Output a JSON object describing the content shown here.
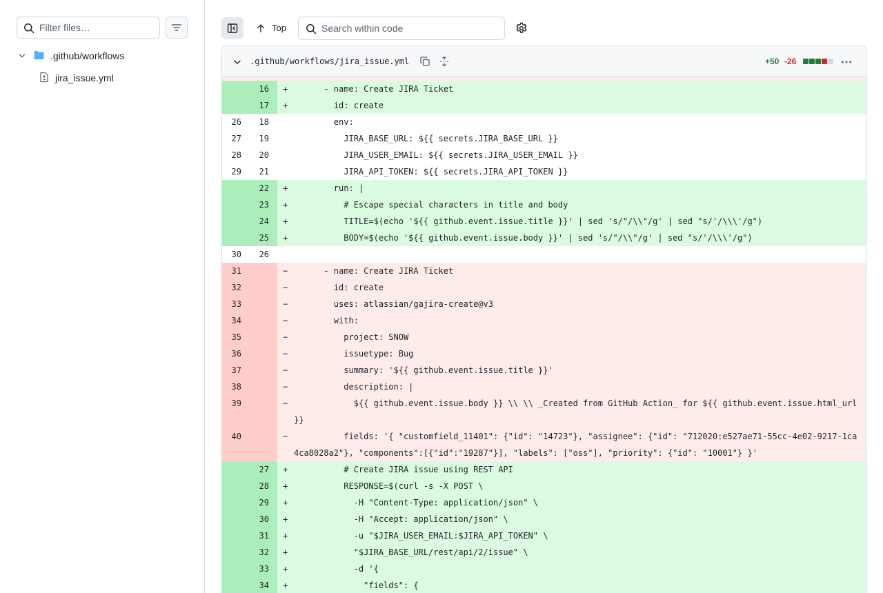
{
  "sidebar": {
    "filter_placeholder": "Filter files…",
    "tree": {
      "folder": ".github/workflows",
      "file": "jira_issue.yml"
    }
  },
  "toolbar": {
    "top_label": "Top",
    "search_placeholder": "Search within code"
  },
  "diff": {
    "file_path": ".github/workflows/jira_issue.yml",
    "additions": "+50",
    "deletions": "-26",
    "blocks": [
      "add",
      "add",
      "add",
      "del",
      "neu"
    ],
    "lines": [
      {
        "type": "add",
        "old": "",
        "new": "16",
        "marker": "+",
        "code": "      - name: Create JIRA Ticket"
      },
      {
        "type": "add",
        "old": "",
        "new": "17",
        "marker": "+",
        "code": "        id: create"
      },
      {
        "type": "ctx",
        "old": "26",
        "new": "18",
        "marker": "",
        "code": "        env:"
      },
      {
        "type": "ctx",
        "old": "27",
        "new": "19",
        "marker": "",
        "code": "          JIRA_BASE_URL: ${{ secrets.JIRA_BASE_URL }}"
      },
      {
        "type": "ctx",
        "old": "28",
        "new": "20",
        "marker": "",
        "code": "          JIRA_USER_EMAIL: ${{ secrets.JIRA_USER_EMAIL }}"
      },
      {
        "type": "ctx",
        "old": "29",
        "new": "21",
        "marker": "",
        "code": "          JIRA_API_TOKEN: ${{ secrets.JIRA_API_TOKEN }}"
      },
      {
        "type": "add",
        "old": "",
        "new": "22",
        "marker": "+",
        "code": "        run: |"
      },
      {
        "type": "add",
        "old": "",
        "new": "23",
        "marker": "+",
        "code": "          # Escape special characters in title and body"
      },
      {
        "type": "add",
        "old": "",
        "new": "24",
        "marker": "+",
        "code": "          TITLE=$(echo '${{ github.event.issue.title }}' | sed 's/\"/\\\\\"/g' | sed \"s/'/\\\\\\'/g\")"
      },
      {
        "type": "add",
        "old": "",
        "new": "25",
        "marker": "+",
        "code": "          BODY=$(echo '${{ github.event.issue.body }}' | sed 's/\"/\\\\\"/g' | sed \"s/'/\\\\\\'/g\")"
      },
      {
        "type": "ctx",
        "old": "30",
        "new": "26",
        "marker": "",
        "code": ""
      },
      {
        "type": "del",
        "old": "31",
        "new": "",
        "marker": "−",
        "code": "      - name: Create JIRA Ticket"
      },
      {
        "type": "del",
        "old": "32",
        "new": "",
        "marker": "−",
        "code": "        id: create"
      },
      {
        "type": "del",
        "old": "33",
        "new": "",
        "marker": "−",
        "code": "        uses: atlassian/gajira-create@v3"
      },
      {
        "type": "del",
        "old": "34",
        "new": "",
        "marker": "−",
        "code": "        with:"
      },
      {
        "type": "del",
        "old": "35",
        "new": "",
        "marker": "−",
        "code": "          project: SNOW"
      },
      {
        "type": "del",
        "old": "36",
        "new": "",
        "marker": "−",
        "code": "          issuetype: Bug"
      },
      {
        "type": "del",
        "old": "37",
        "new": "",
        "marker": "−",
        "code": "          summary: '${{ github.event.issue.title }}'"
      },
      {
        "type": "del",
        "old": "38",
        "new": "",
        "marker": "−",
        "code": "          description: |"
      },
      {
        "type": "del",
        "old": "39",
        "new": "",
        "marker": "−",
        "code": "            ${{ github.event.issue.body }} \\\\ \\\\ _Created from GitHub Action_ for ${{ github.event.issue.html_url }}",
        "tall": true
      },
      {
        "type": "del",
        "old": "40",
        "new": "",
        "marker": "−",
        "code": "          fields: '{ \"customfield_11401\": {\"id\": \"14723\"}, \"assignee\": {\"id\": \"712020:e527ae71-55cc-4e02-9217-1ca4ca8028a2\"}, \"components\":[{\"id\":\"19287\"}], \"labels\": [\"oss\"], \"priority\": {\"id\": \"10001\"} }'",
        "tall": true
      },
      {
        "type": "add",
        "old": "",
        "new": "27",
        "marker": "+",
        "code": "          # Create JIRA issue using REST API"
      },
      {
        "type": "add",
        "old": "",
        "new": "28",
        "marker": "+",
        "code": "          RESPONSE=$(curl -s -X POST \\"
      },
      {
        "type": "add",
        "old": "",
        "new": "29",
        "marker": "+",
        "code": "            -H \"Content-Type: application/json\" \\"
      },
      {
        "type": "add",
        "old": "",
        "new": "30",
        "marker": "+",
        "code": "            -H \"Accept: application/json\" \\"
      },
      {
        "type": "add",
        "old": "",
        "new": "31",
        "marker": "+",
        "code": "            -u \"$JIRA_USER_EMAIL:$JIRA_API_TOKEN\" \\"
      },
      {
        "type": "add",
        "old": "",
        "new": "32",
        "marker": "+",
        "code": "            \"$JIRA_BASE_URL/rest/api/2/issue\" \\"
      },
      {
        "type": "add",
        "old": "",
        "new": "33",
        "marker": "+",
        "code": "            -d '{"
      },
      {
        "type": "add",
        "old": "",
        "new": "34",
        "marker": "+",
        "code": "              \"fields\": {"
      }
    ]
  }
}
